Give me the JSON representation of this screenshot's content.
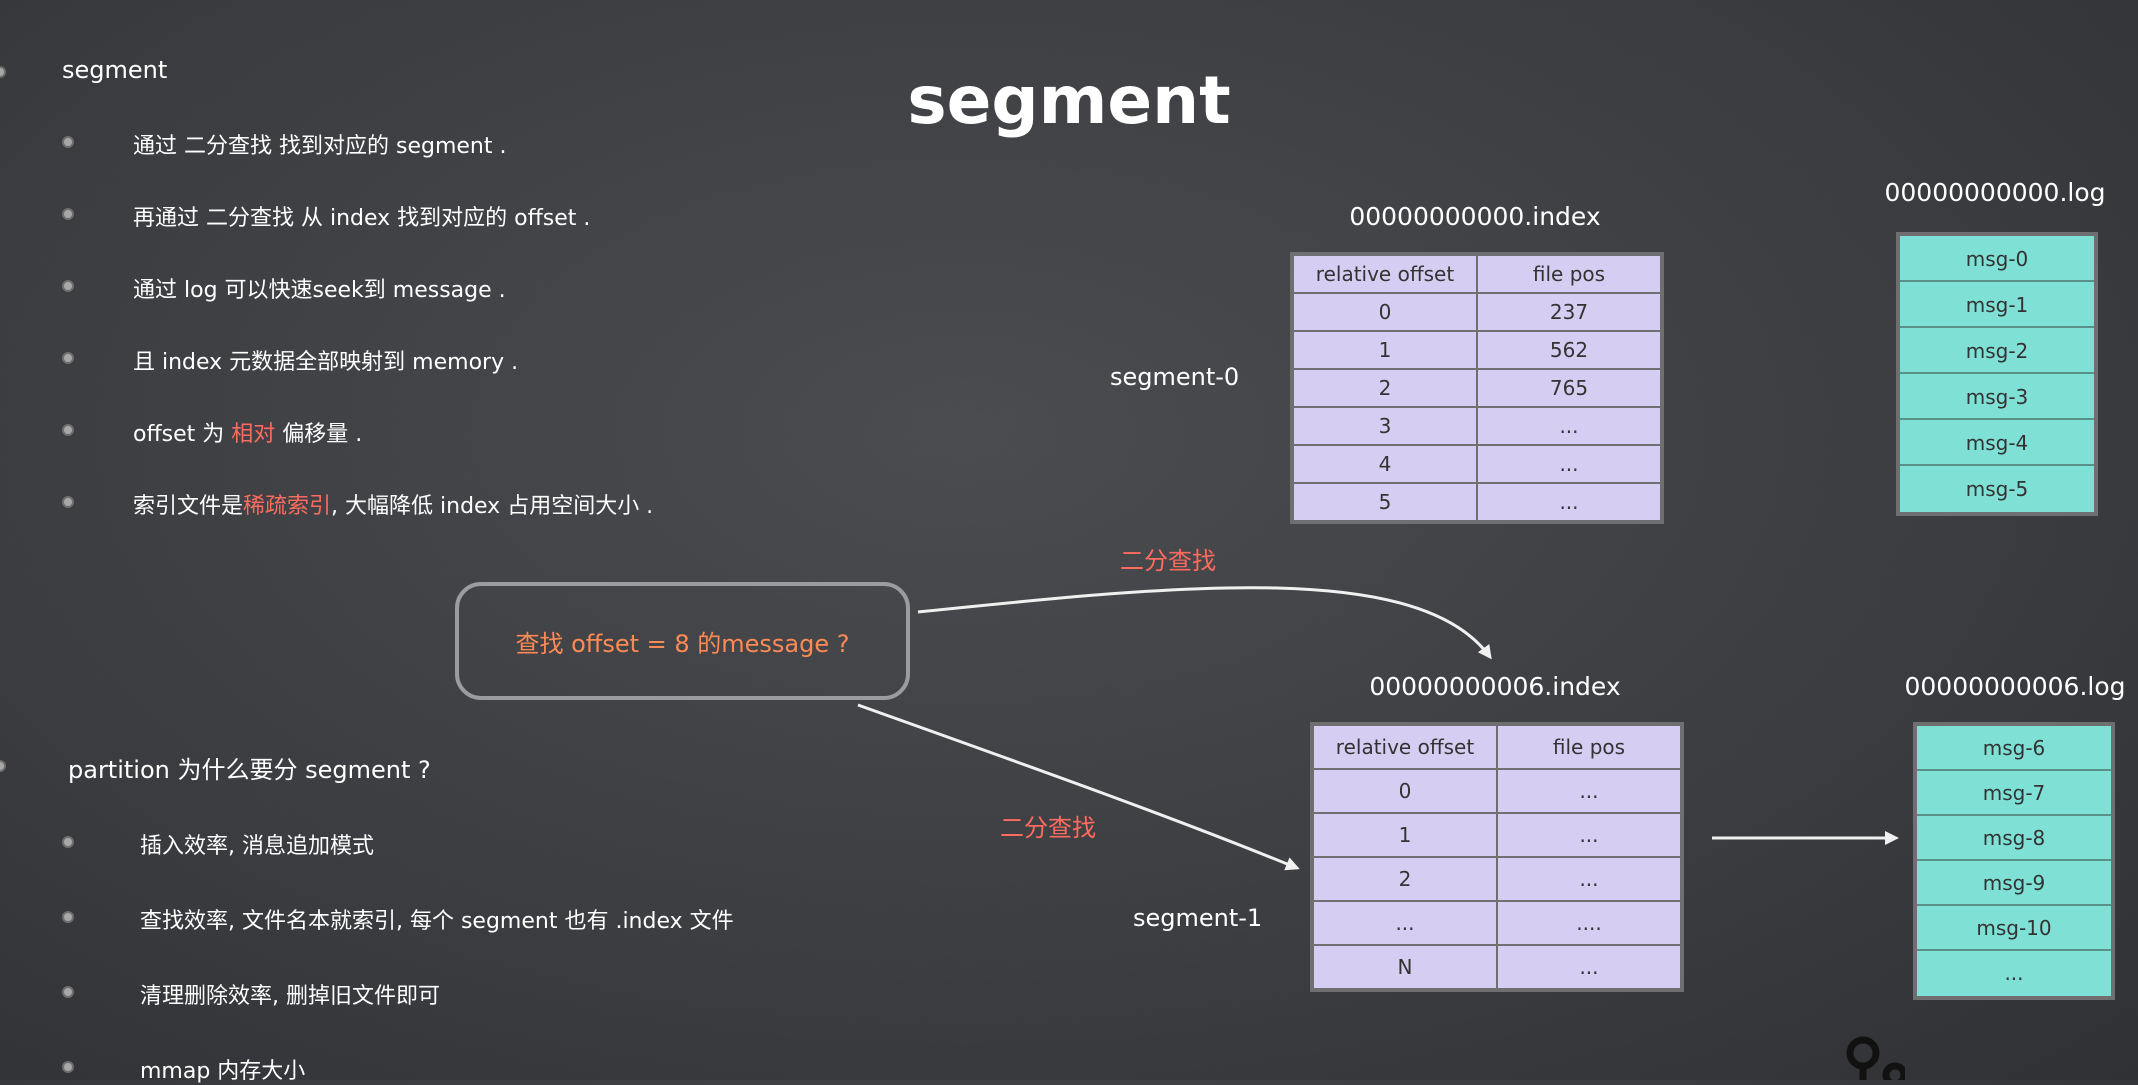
{
  "title": "segment",
  "left_panel": {
    "section1": {
      "heading": "segment",
      "items": [
        [
          {
            "t": "通过 二分查找 找到对应的 segment ."
          }
        ],
        [
          {
            "t": "再通过 二分查找 从 index 找到对应的 offset ."
          }
        ],
        [
          {
            "t": "通过 log 可以快速seek到 message ."
          }
        ],
        [
          {
            "t": "且 index 元数据全部映射到 memory ."
          }
        ],
        [
          {
            "t": "offset 为 "
          },
          {
            "t": "相对",
            "hl": true
          },
          {
            "t": " 偏移量 ."
          }
        ],
        [
          {
            "t": "索引文件是"
          },
          {
            "t": "稀疏索引",
            "hl": true
          },
          {
            "t": ", 大幅降低 index 占用空间大小 ."
          }
        ]
      ]
    },
    "section2": {
      "heading": "partition 为什么要分 segment ?",
      "items": [
        [
          {
            "t": "插入效率, 消息追加模式"
          }
        ],
        [
          {
            "t": "查找效率, 文件名本就索引, 每个 segment 也有 .index 文件"
          }
        ],
        [
          {
            "t": "清理删除效率, 删掉旧文件即可"
          }
        ],
        [
          {
            "t": "mmap 内存大小"
          }
        ]
      ]
    }
  },
  "query": "查找 offset = 8 的message ?",
  "arrow_labels": {
    "upper": "二分查找",
    "lower": "二分查找"
  },
  "segment0": {
    "label": "segment-0",
    "index_file": "00000000000.index",
    "log_file": "00000000000.log",
    "header": [
      "relative offset",
      "file pos"
    ],
    "rows": [
      [
        "0",
        "237"
      ],
      [
        "1",
        "562"
      ],
      [
        "2",
        "765"
      ],
      [
        "3",
        "..."
      ],
      [
        "4",
        "..."
      ],
      [
        "5",
        "..."
      ]
    ],
    "log": [
      "msg-0",
      "msg-1",
      "msg-2",
      "msg-3",
      "msg-4",
      "msg-5"
    ]
  },
  "segment1": {
    "label": "segment-1",
    "index_file": "00000000006.index",
    "log_file": "00000000006.log",
    "header": [
      "relative offset",
      "file pos"
    ],
    "rows": [
      [
        "0",
        "..."
      ],
      [
        "1",
        "..."
      ],
      [
        "2",
        "..."
      ],
      [
        "...",
        "...."
      ],
      [
        "N",
        "..."
      ]
    ],
    "log": [
      "msg-6",
      "msg-7",
      "msg-8",
      "msg-9",
      "msg-10",
      "..."
    ]
  },
  "colors": {
    "highlight": "#ff6b5e",
    "query_text": "#ff8a55",
    "index_bg": "#d6cdf2",
    "log_bg": "#7fe0d6"
  }
}
